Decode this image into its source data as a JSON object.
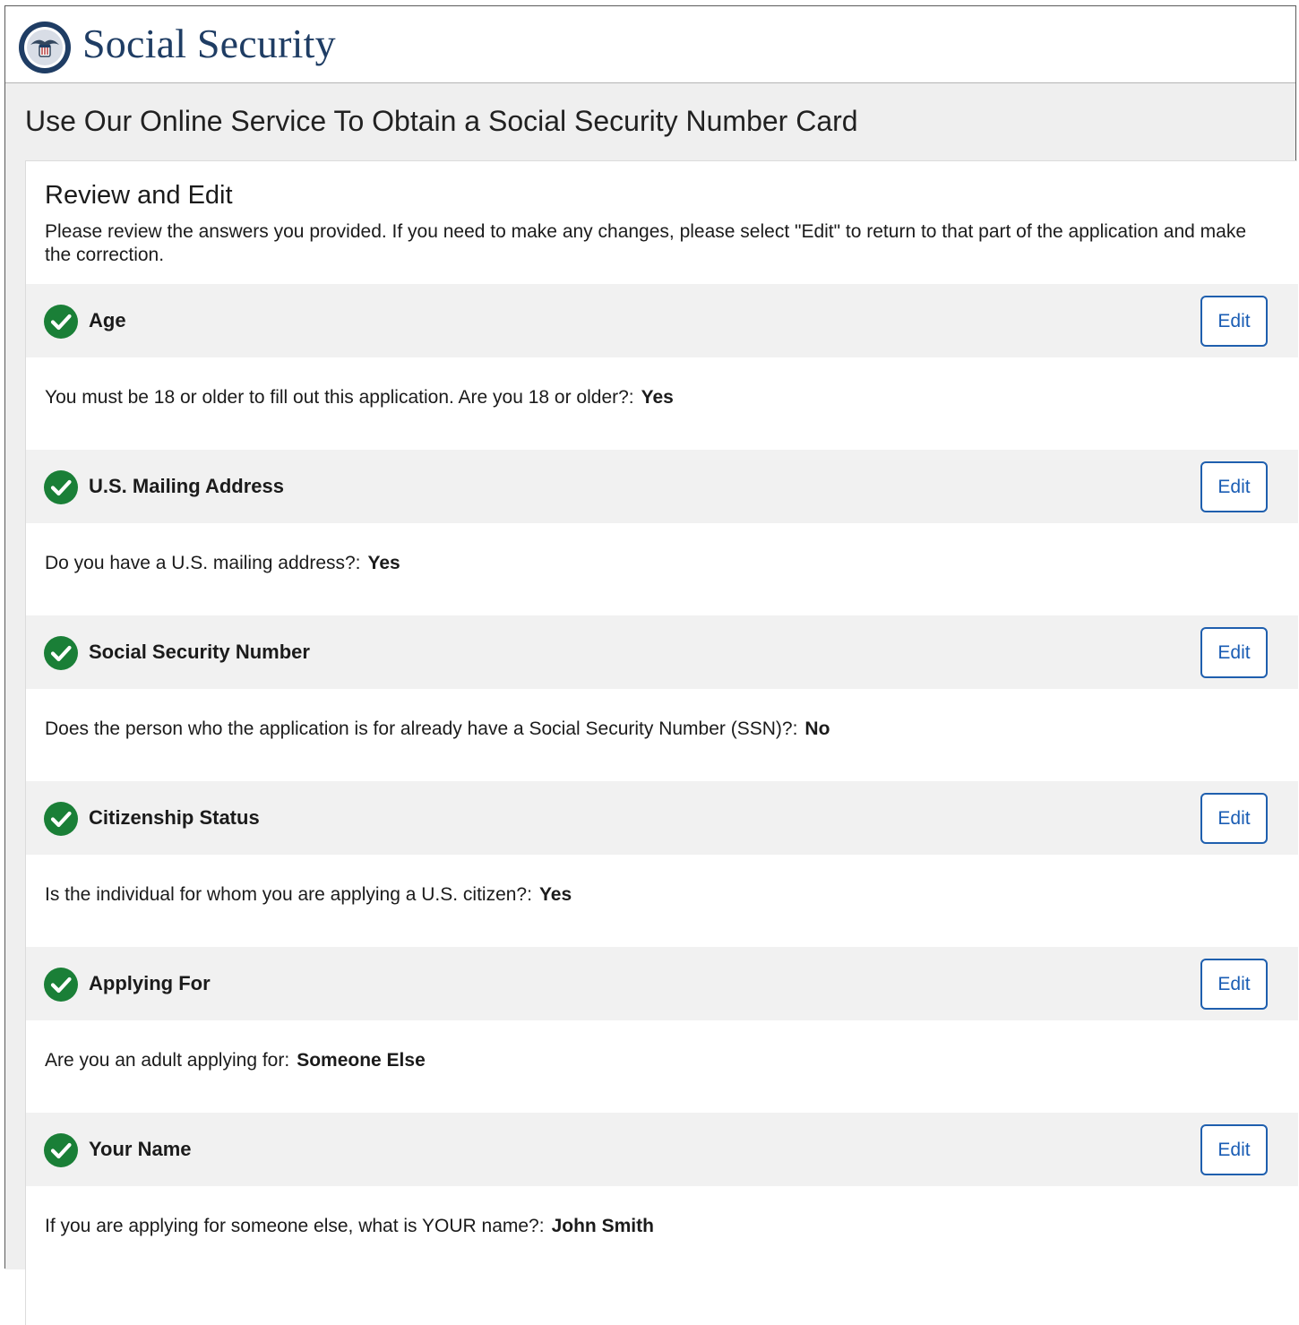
{
  "header": {
    "brand": "Social Security",
    "logo_icon": "ssa-seal-icon"
  },
  "page": {
    "title": "Use Our Online Service To Obtain a Social Security Number Card"
  },
  "review": {
    "title": "Review and Edit",
    "intro": "Please review the answers you provided. If you need to make any changes, please select \"Edit\" to return to that part of the application and make the correction.",
    "edit_label": "Edit",
    "status_icon": "check-circle-icon",
    "sections": [
      {
        "title": "Age",
        "question": "You must be 18 or older to fill out this application. Are you 18 or older?:",
        "answer": "Yes"
      },
      {
        "title": "U.S. Mailing Address",
        "question": "Do you have a U.S. mailing address?:",
        "answer": "Yes"
      },
      {
        "title": "Social Security Number",
        "question": "Does the person who the application is for already have a Social Security Number (SSN)?:",
        "answer": "No"
      },
      {
        "title": "Citizenship Status",
        "question": "Is the individual for whom you are applying a U.S. citizen?:",
        "answer": "Yes"
      },
      {
        "title": "Applying For",
        "question": "Are you an adult applying for:",
        "answer": "Someone Else"
      },
      {
        "title": "Your Name",
        "question": "If you are applying for someone else, what is YOUR name?:",
        "answer": "John Smith"
      }
    ]
  },
  "colors": {
    "brand_text": "#1f3d64",
    "check_green": "#1a7f37",
    "edit_blue": "#1a5db4"
  }
}
